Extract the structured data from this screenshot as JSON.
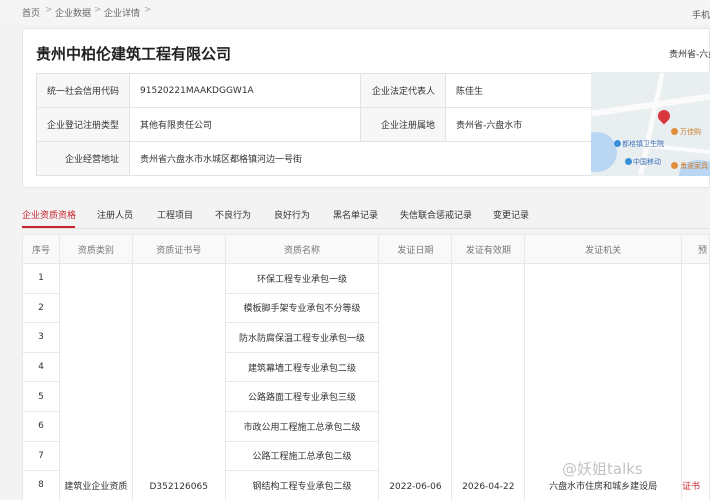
{
  "breadcrumb": {
    "home": "首页",
    "data": "企业数据",
    "detail": "企业详情",
    "sep": ">"
  },
  "header_right": "手机",
  "company": {
    "name": "贵州中柏伦建筑工程有限公司",
    "region_short": "贵州省-六盘",
    "fields": {
      "credit_code_label": "统一社会信用代码",
      "credit_code": "91520221MAAKDGGW1A",
      "legal_rep_label": "企业法定代表人",
      "legal_rep": "陈佳生",
      "reg_type_label": "企业登记注册类型",
      "reg_type": "其他有限责任公司",
      "reg_place_label": "企业注册属地",
      "reg_place": "贵州省-六盘水市",
      "address_label": "企业经营地址",
      "address": "贵州省六盘水市水城区都格镇河边一号街"
    },
    "map": {
      "poi_1": "万佳购",
      "poi_2": "都格镇卫生院",
      "poi_3": "中国移动",
      "poi_4": "勇波家具"
    }
  },
  "tabs": [
    "企业资质资格",
    "注册人员",
    "工程项目",
    "不良行为",
    "良好行为",
    "黑名单记录",
    "失信联合惩戒记录",
    "变更记录"
  ],
  "table": {
    "headers": [
      "序号",
      "资质类别",
      "资质证书号",
      "资质名称",
      "发证日期",
      "发证有效期",
      "发证机关",
      "预"
    ],
    "rows": [
      {
        "no": "1",
        "name": "环保工程专业承包一级"
      },
      {
        "no": "2",
        "name": "模板脚手架专业承包不分等级"
      },
      {
        "no": "3",
        "name": "防水防腐保温工程专业承包一级"
      },
      {
        "no": "4",
        "name": "建筑幕墙工程专业承包二级"
      },
      {
        "no": "5",
        "name": "公路路面工程专业承包三级"
      },
      {
        "no": "6",
        "name": "市政公用工程施工总承包二级"
      },
      {
        "no": "7",
        "name": "公路工程施工总承包二级"
      },
      {
        "no": "8",
        "name": "钢结构工程专业承包二级"
      }
    ],
    "category": "建筑业企业资质",
    "cert_no": "D352126065",
    "issue_date": "2022-06-06",
    "valid_until": "2026-04-22",
    "authority": "六盘水市住房和城乡建设局",
    "last_col_value": "证书"
  },
  "watermark": "@妖姐talks",
  "colors": {
    "accent": "#c8262e",
    "header_bg": "#f9f9f9",
    "border": "#e8e8e8"
  }
}
